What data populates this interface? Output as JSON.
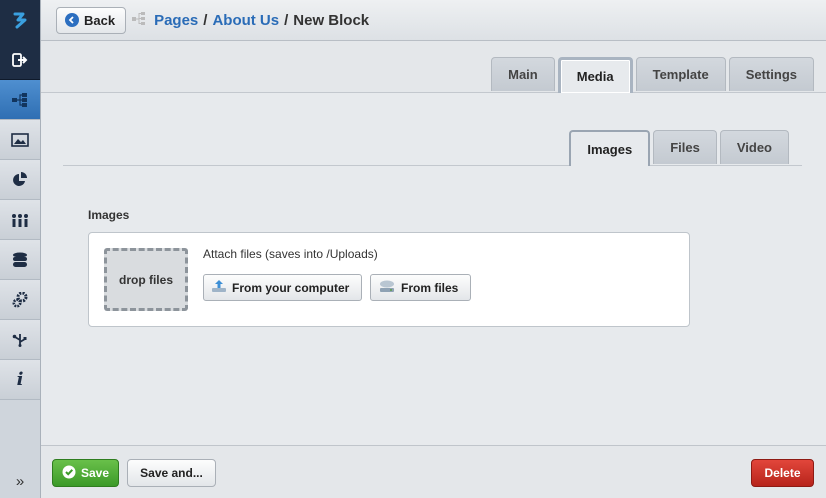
{
  "sidebar": {
    "items": [
      {
        "icon": "logo-icon"
      },
      {
        "icon": "sign-out-icon"
      },
      {
        "icon": "sitemap-icon"
      },
      {
        "icon": "image-icon"
      },
      {
        "icon": "pie-chart-icon"
      },
      {
        "icon": "users-icon"
      },
      {
        "icon": "database-icon"
      },
      {
        "icon": "gears-icon"
      },
      {
        "icon": "usb-icon"
      },
      {
        "icon": "info-icon"
      }
    ],
    "expand_label": "»"
  },
  "header": {
    "back_label": "Back",
    "breadcrumb": {
      "pages": "Pages",
      "sep1": "/",
      "about": "About Us",
      "sep2": "/",
      "current": "New Block"
    }
  },
  "tabs": {
    "main": "Main",
    "media": "Media",
    "template": "Template",
    "settings": "Settings"
  },
  "subtabs": {
    "images": "Images",
    "files": "Files",
    "video": "Video"
  },
  "images_section": {
    "label": "Images",
    "dropzone": "drop files",
    "attach_text": "Attach files (saves into /Uploads)",
    "from_computer": "From your computer",
    "from_files": "From files"
  },
  "footer": {
    "save": "Save",
    "save_and": "Save and...",
    "delete": "Delete"
  },
  "colors": {
    "link": "#2a6cb7",
    "save_green": "#4caf35",
    "delete_red": "#cc2f24",
    "sidebar_dark": "#1e2d44",
    "sidebar_active": "#3c7fc4"
  }
}
